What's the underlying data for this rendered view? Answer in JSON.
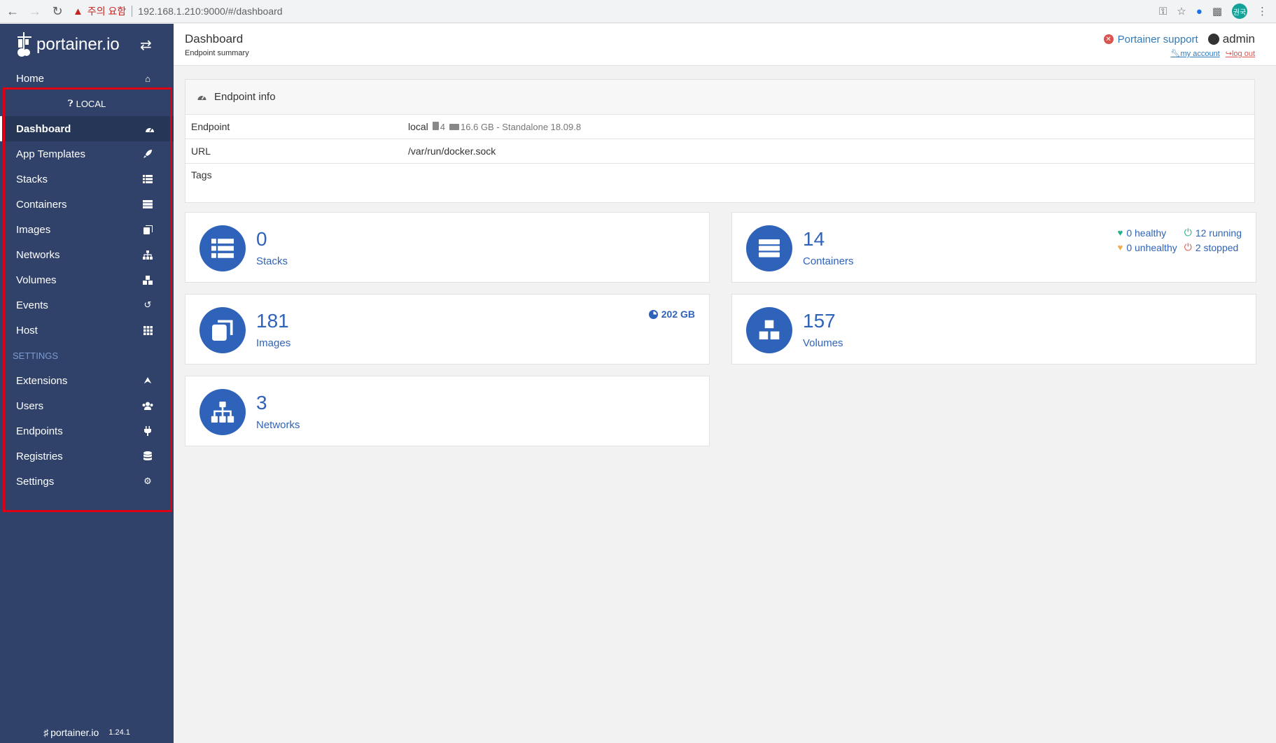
{
  "browser": {
    "warning": "주의 요함",
    "url": "192.168.1.210:9000/#/dashboard",
    "profile_initials": "권국"
  },
  "sidebar": {
    "brand": "portainer.io",
    "home": "Home",
    "endpoint": "LOCAL",
    "items": [
      {
        "label": "Dashboard",
        "icon": "tachometer-icon"
      },
      {
        "label": "App Templates",
        "icon": "rocket-icon"
      },
      {
        "label": "Stacks",
        "icon": "th-list-icon"
      },
      {
        "label": "Containers",
        "icon": "server-icon"
      },
      {
        "label": "Images",
        "icon": "clone-icon"
      },
      {
        "label": "Networks",
        "icon": "sitemap-icon"
      },
      {
        "label": "Volumes",
        "icon": "cubes-icon"
      },
      {
        "label": "Events",
        "icon": "history-icon"
      },
      {
        "label": "Host",
        "icon": "th-icon"
      }
    ],
    "settings_title": "SETTINGS",
    "settings_items": [
      {
        "label": "Extensions",
        "icon": "bolt-icon"
      },
      {
        "label": "Users",
        "icon": "users-icon"
      },
      {
        "label": "Endpoints",
        "icon": "plug-icon"
      },
      {
        "label": "Registries",
        "icon": "database-icon"
      },
      {
        "label": "Settings",
        "icon": "cogs-icon"
      }
    ],
    "footer_brand": "portainer.io",
    "version": "1.24.1"
  },
  "header": {
    "title": "Dashboard",
    "subtitle": "Endpoint summary",
    "support": "Portainer support",
    "user": "admin",
    "my_account": "my account",
    "log_out": "log out"
  },
  "endpoint_info": {
    "title": "Endpoint info",
    "rows": [
      {
        "key": "Endpoint",
        "name": "local",
        "cpu": "4",
        "memory": "16.6 GB - Standalone 18.09.8"
      },
      {
        "key": "URL",
        "value": "/var/run/docker.sock"
      },
      {
        "key": "Tags",
        "value": ""
      }
    ]
  },
  "tiles": {
    "stacks": {
      "count": "0",
      "label": "Stacks"
    },
    "containers": {
      "count": "14",
      "label": "Containers",
      "healthy": "0 healthy",
      "unhealthy": "0 unhealthy",
      "running": "12 running",
      "stopped": "2 stopped"
    },
    "images": {
      "count": "181",
      "label": "Images",
      "size": "202 GB"
    },
    "volumes": {
      "count": "157",
      "label": "Volumes"
    },
    "networks": {
      "count": "3",
      "label": "Networks"
    }
  },
  "colors": {
    "sidebar_bg": "#30426a",
    "accent": "#2f63ba",
    "highlight": "#e00016"
  }
}
